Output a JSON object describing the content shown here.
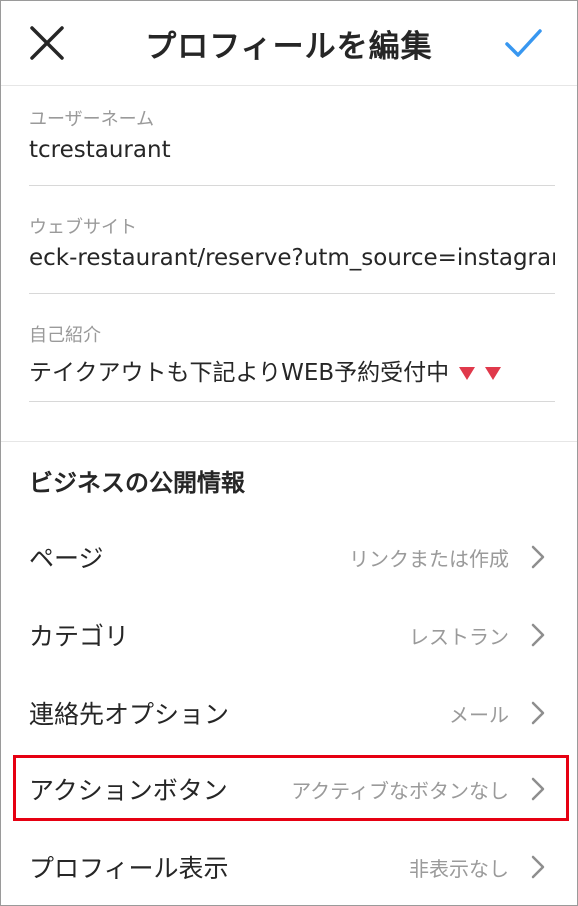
{
  "header": {
    "title": "プロフィールを編集",
    "close_icon": "close-icon",
    "confirm_icon": "check-icon",
    "accent_color": "#3897f0"
  },
  "fields": {
    "username": {
      "label": "ユーザーネーム",
      "value": "tcrestaurant"
    },
    "website": {
      "label": "ウェブサイト",
      "value": "eck-restaurant/reserve?utm_source=instagram"
    },
    "bio": {
      "label": "自己紹介",
      "value": "テイクアウトも下記よりWEB予約受付中",
      "icons": [
        "red-triangle-down-icon",
        "red-triangle-down-icon"
      ]
    }
  },
  "business": {
    "section_title": "ビジネスの公開情報",
    "rows": [
      {
        "label": "ページ",
        "value": "リンクまたは作成"
      },
      {
        "label": "カテゴリ",
        "value": "レストラン"
      },
      {
        "label": "連絡先オプション",
        "value": "メール"
      },
      {
        "label": "アクションボタン",
        "value": "アクティブなボタンなし"
      },
      {
        "label": "プロフィール表示",
        "value": "非表示なし"
      }
    ],
    "highlight_color": "#e60012"
  }
}
